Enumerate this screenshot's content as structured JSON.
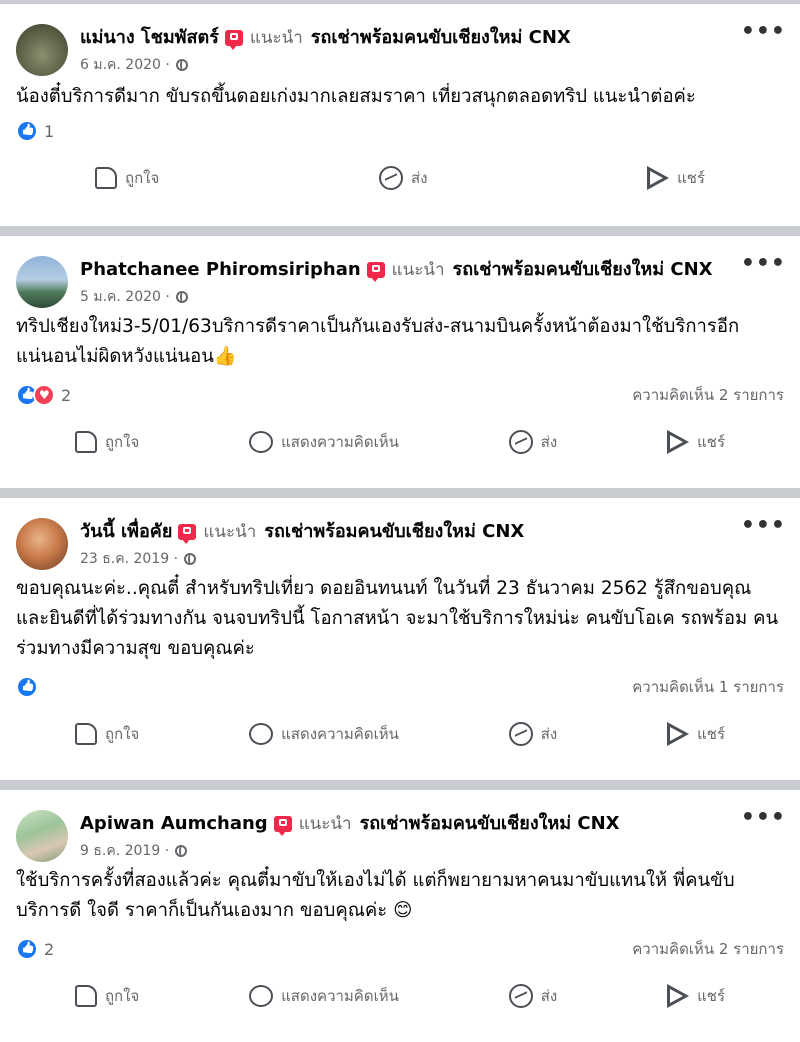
{
  "colors": {
    "like_blue": "#1877f2",
    "love_red": "#f33e58",
    "recommend_red": "#f02849",
    "meta_gray": "#65676b"
  },
  "actions": {
    "like": "ถูกใจ",
    "comment": "แสดงความคิดเห็น",
    "send": "ส่ง",
    "share": "แชร์"
  },
  "posts": [
    {
      "author": "แม่นาง โชมพัสตร์",
      "recommends": "แนะนำ",
      "page": "รถเช่าพร้อมคนขับเชียงใหม่ CNX",
      "date": "6 ม.ค. 2020 ·",
      "text": "น้องตี๋บริการดีมาก  ขับรถขึ้นดอยเก่งมากเลยสมราคา  เที่ยวสนุกตลอดทริป  แนะนำต่อค่ะ",
      "reaction_count": "1",
      "reactions": [
        "like"
      ],
      "comments": ""
    },
    {
      "author": "Phatchanee Phiromsiriphan",
      "recommends": "แนะนำ",
      "page": "รถเช่าพร้อมคนขับเชียงใหม่ CNX",
      "date": "5 ม.ค. 2020 ·",
      "text": "ทริปเชียงใหม่3-5/01/63บริการดีราคาเป็นกันเองรับส่ง-สนามบินครั้งหน้าต้องมาใช้บริการอีกแน่นอนไม่ผิดหวังแน่นอน👍",
      "reaction_count": "2",
      "reactions": [
        "like",
        "love"
      ],
      "comments": "ความคิดเห็น 2 รายการ"
    },
    {
      "author": "วันนี้ เพื่อคัย",
      "recommends": "แนะนำ",
      "page": "รถเช่าพร้อมคนขับเชียงใหม่ CNX",
      "date": "23 ธ.ค. 2019 ·",
      "text": "ขอบคุณนะค่ะ..คุณตี๋ สำหรับทริปเที่ยว ดอยอินทนนท์ ในวันที่ 23 ธันวาคม 2562 รู้สึกขอบคุณ และยินดีที่ได้ร่วมทางกัน จนจบทริปนี้ โอกาสหน้า จะมาใช้บริการใหม่น่ะ คนขับโอเค รถพร้อม คนร่วมทางมีความสุข ขอบคุณค่ะ",
      "reaction_count": "",
      "reactions": [
        "like"
      ],
      "comments": "ความคิดเห็น 1 รายการ"
    },
    {
      "author": "Apiwan Aumchang",
      "recommends": "แนะนำ",
      "page": "รถเช่าพร้อมคนขับเชียงใหม่ CNX",
      "date": "9 ธ.ค. 2019 ·",
      "text": "ใช้บริการครั้งที่สองแล้วค่ะ คุณตี๋มาขับให้เองไม่ได้ แต่ก็พยายามหาคนมาขับแทนให้ พี่คนขับบริการดี ใจดี ราคาก็เป็นกันเองมาก ขอบคุณค่ะ 😊",
      "reaction_count": "2",
      "reactions": [
        "like"
      ],
      "comments": "ความคิดเห็น 2 รายการ"
    }
  ]
}
